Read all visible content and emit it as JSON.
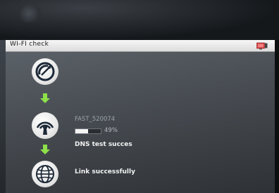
{
  "title_bar": {
    "title": "WI-FI check",
    "icon": "tv-icon"
  },
  "steps": [
    {
      "icon": "satellite-dish-icon"
    },
    {
      "icon": "wifi-signal-icon",
      "ssid": "FAST_520074",
      "progress_percent": 49,
      "progress_label": "49%",
      "status": "DNS test succes"
    },
    {
      "icon": "globe-icon",
      "status": "Link successfully"
    }
  ],
  "colors": {
    "arrow": "#8ee04a",
    "title_bar": "#efefef",
    "panel": "#4a4f55"
  }
}
